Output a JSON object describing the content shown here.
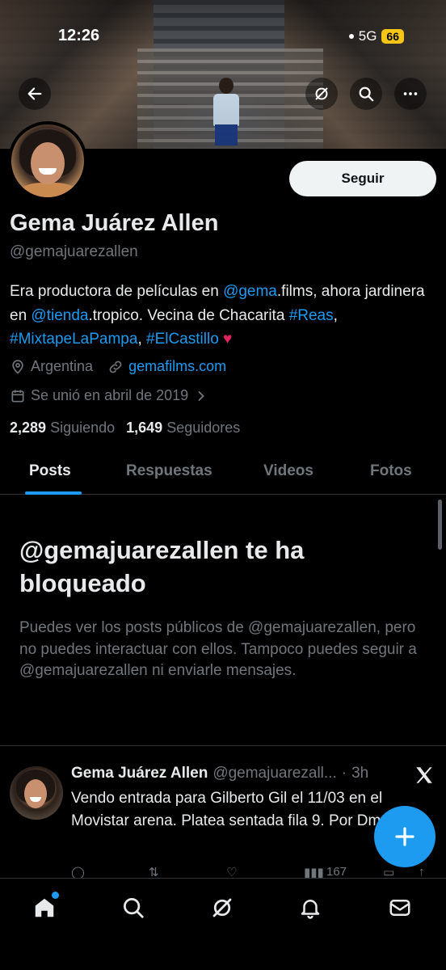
{
  "status_bar": {
    "time": "12:26",
    "network": "5G",
    "battery": "66"
  },
  "profile": {
    "display_name": "Gema Juárez Allen",
    "handle": "@gemajuarezallen",
    "follow_label": "Seguir",
    "bio": {
      "p1": "Era productora de películas en ",
      "link1": "@gema",
      "p2": ".films, ahora jardinera en ",
      "link2": "@tienda",
      "p3": ".tropico. Vecina de Chacarita ",
      "tag1": "#Reas",
      "sep1": ", ",
      "tag2": "#MixtapeLaPampa",
      "sep2": ", ",
      "tag3": "#ElCastillo",
      "emoji": "♥"
    },
    "location": "Argentina",
    "website": "gemafilms.com",
    "joined": "Se unió en abril de 2019",
    "following_count": "2,289",
    "following_label": "Siguiendo",
    "followers_count": "1,649",
    "followers_label": "Seguidores"
  },
  "tabs": [
    "Posts",
    "Respuestas",
    "Videos",
    "Fotos"
  ],
  "blocked": {
    "title": "@gemajuarezallen te ha bloqueado",
    "description": "Puedes ver los posts públicos de @gemajuarezallen, pero no puedes interactuar con ellos. Tampoco puedes seguir a @gemajuarezallen ni enviarle mensajes."
  },
  "post": {
    "author": "Gema Juárez Allen",
    "handle": "@gemajuarezall...",
    "dot": "·",
    "time": "3h",
    "text": "Vendo entrada para Gilberto Gil el 11/03 en el Movistar arena. Platea sentada fila 9. Por Dm",
    "views": "167"
  },
  "colors": {
    "accent": "#1d9bf0",
    "background": "#000000",
    "muted": "#71767b",
    "text": "#e7e9ea",
    "battery": "#f5c518"
  },
  "icons": {
    "banner": [
      "back-arrow-icon",
      "grok-icon",
      "search-icon",
      "more-icon"
    ],
    "nav": [
      "home-icon",
      "search-icon",
      "grok-icon",
      "notifications-icon",
      "messages-icon"
    ],
    "fab": "plus-icon"
  }
}
